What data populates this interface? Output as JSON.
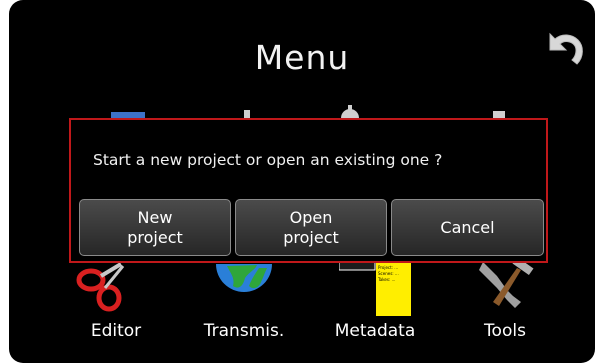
{
  "header": {
    "title": "Menu",
    "back_icon": "undo-arrow-icon"
  },
  "menu_items": [
    {
      "label": "Editor",
      "icon": "scissors-icon"
    },
    {
      "label": "Transmis.",
      "icon": "globe-icon"
    },
    {
      "label": "Metadata",
      "icon": "sticky-note-icon"
    },
    {
      "label": "Tools",
      "icon": "wrench-hammer-icon"
    }
  ],
  "dialog": {
    "prompt": "Start a new project or open an existing one ?",
    "buttons": {
      "new_project": "New\nproject",
      "open_project": "Open\nproject",
      "cancel": "Cancel"
    }
  },
  "note_text": [
    "Project: ...",
    "Scenes: ...",
    "Takes: ..."
  ],
  "colors": {
    "background": "#000000",
    "dialog_border": "#c0181a",
    "note": "#ffee00"
  }
}
